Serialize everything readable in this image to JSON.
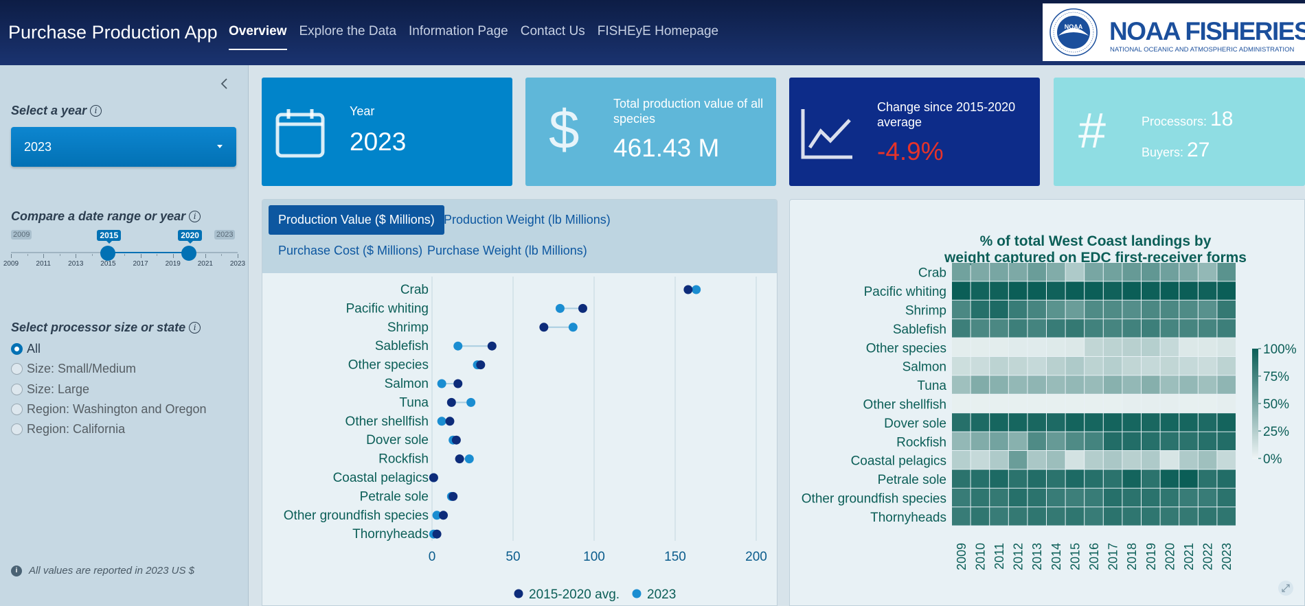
{
  "header": {
    "app_title": "Purchase Production App",
    "nav": [
      {
        "label": "Overview",
        "active": true
      },
      {
        "label": "Explore the Data",
        "active": false
      },
      {
        "label": "Information Page",
        "active": false
      },
      {
        "label": "Contact Us",
        "active": false
      },
      {
        "label": "FISHEyE Homepage",
        "active": false
      }
    ],
    "logo": {
      "emblem_text": "NOAA",
      "name": "NOAA FISHERIES",
      "subtitle": "NATIONAL OCEANIC AND ATMOSPHERIC ADMINISTRATION"
    }
  },
  "sidebar": {
    "year_label": "Select a year",
    "year_value": "2023",
    "range_label": "Compare a date range or year",
    "range": {
      "min": 2009,
      "max": 2023,
      "start": 2015,
      "end": 2020,
      "min_label": "2009",
      "max_label": "2023",
      "start_label": "2015",
      "end_label": "2020",
      "ticks": [
        "2009",
        "2011",
        "2013",
        "2015",
        "2017",
        "2019",
        "2021",
        "2023"
      ]
    },
    "processor_label": "Select processor size or state",
    "options": [
      {
        "label": "All",
        "checked": true
      },
      {
        "label": "Size: Small/Medium",
        "checked": false
      },
      {
        "label": "Size: Large",
        "checked": false
      },
      {
        "label": "Region: Washington and Oregon",
        "checked": false
      },
      {
        "label": "Region: California",
        "checked": false
      }
    ],
    "footnote": "All values are reported in 2023 US $"
  },
  "cards": {
    "year": {
      "label": "Year",
      "value": "2023",
      "icon": "calendar-icon"
    },
    "total": {
      "label": "Total production value of all species",
      "value": "461.43 M",
      "icon": "dollar-icon"
    },
    "change": {
      "label": "Change since 2015-2020 average",
      "value": "-4.9%",
      "value_color": "#e6332a",
      "icon": "line-chart-icon"
    },
    "counts": {
      "processors_label": "Processors:",
      "processors": "18",
      "buyers_label": "Buyers:",
      "buyers": "27",
      "icon": "hash-icon"
    }
  },
  "tabs": [
    {
      "label": "Production Value ($ Millions)",
      "active": true
    },
    {
      "label": "Production Weight (lb Millions)",
      "active": false
    },
    {
      "label": "Purchase Cost ($ Millions)",
      "active": false
    },
    {
      "label": "Purchase Weight (lb Millions)",
      "active": false
    }
  ],
  "colors": {
    "avg": "#0d2c7a",
    "year": "#1a8dd1",
    "heat_high": "#0b5e57",
    "heat_low": "#eef4f5",
    "accent": "#0271b4"
  },
  "chart_data": [
    {
      "type": "scatter",
      "subtype": "dumbbell",
      "categories": [
        "Crab",
        "Pacific whiting",
        "Shrimp",
        "Sablefish",
        "Other species",
        "Salmon",
        "Tuna",
        "Other shellfish",
        "Dover sole",
        "Rockfish",
        "Coastal pelagics",
        "Petrale sole",
        "Other groundfish species",
        "Thornyheads"
      ],
      "series": [
        {
          "name": "2015-2020 avg.",
          "values": [
            158,
            93,
            69,
            37,
            30,
            16,
            12,
            11,
            15,
            17,
            1,
            13,
            7,
            3
          ]
        },
        {
          "name": "2023",
          "values": [
            163,
            79,
            87,
            16,
            28,
            6,
            24,
            6,
            13,
            23,
            1,
            12,
            3,
            1
          ]
        }
      ],
      "xlim": [
        0,
        200
      ],
      "xticks": [
        "0",
        "50",
        "100",
        "150",
        "200"
      ],
      "legend_position": "bottom",
      "grid": true
    },
    {
      "type": "heatmap",
      "title": "% of total West Coast landings by weight captured on EDC first-receiver forms",
      "x": [
        "2009",
        "2010",
        "2011",
        "2012",
        "2013",
        "2014",
        "2015",
        "2016",
        "2017",
        "2018",
        "2019",
        "2020",
        "2021",
        "2022",
        "2023"
      ],
      "y": [
        "Crab",
        "Pacific whiting",
        "Shrimp",
        "Sablefish",
        "Other species",
        "Salmon",
        "Tuna",
        "Other shellfish",
        "Dover sole",
        "Rockfish",
        "Coastal pelagics",
        "Petrale sole",
        "Other groundfish species",
        "Thornyheads"
      ],
      "values": [
        [
          55,
          50,
          52,
          50,
          58,
          48,
          28,
          52,
          55,
          60,
          62,
          56,
          50,
          40,
          65
        ],
        [
          100,
          97,
          98,
          100,
          100,
          98,
          100,
          100,
          98,
          100,
          99,
          100,
          100,
          98,
          100
        ],
        [
          72,
          88,
          92,
          80,
          74,
          65,
          58,
          70,
          70,
          68,
          72,
          72,
          70,
          66,
          82
        ],
        [
          78,
          72,
          72,
          78,
          75,
          80,
          82,
          76,
          74,
          76,
          78,
          74,
          74,
          74,
          78
        ],
        [
          5,
          5,
          5,
          6,
          6,
          7,
          8,
          20,
          22,
          24,
          25,
          18,
          8,
          8,
          10
        ],
        [
          15,
          16,
          22,
          20,
          18,
          24,
          28,
          22,
          25,
          20,
          18,
          20,
          18,
          16,
          22
        ],
        [
          35,
          48,
          45,
          40,
          42,
          38,
          40,
          38,
          45,
          40,
          46,
          36,
          40,
          35,
          42
        ],
        [
          3,
          3,
          3,
          3,
          3,
          3,
          3,
          3,
          3,
          4,
          4,
          4,
          3,
          3,
          4
        ],
        [
          88,
          92,
          95,
          95,
          94,
          92,
          96,
          95,
          96,
          95,
          94,
          95,
          95,
          92,
          96
        ],
        [
          40,
          48,
          54,
          45,
          70,
          60,
          70,
          75,
          90,
          90,
          88,
          86,
          86,
          88,
          90
        ],
        [
          25,
          18,
          28,
          58,
          30,
          36,
          12,
          26,
          30,
          24,
          28,
          10,
          28,
          35,
          18
        ],
        [
          86,
          88,
          92,
          86,
          90,
          86,
          92,
          88,
          86,
          96,
          86,
          98,
          100,
          86,
          90
        ],
        [
          80,
          84,
          82,
          88,
          86,
          80,
          78,
          80,
          88,
          86,
          86,
          84,
          80,
          80,
          86
        ],
        [
          80,
          84,
          80,
          82,
          84,
          82,
          84,
          80,
          86,
          84,
          84,
          82,
          82,
          84,
          84
        ]
      ],
      "colorbar_ticks": [
        "100%",
        "75%",
        "50%",
        "25%",
        "0%"
      ],
      "zlim": [
        0,
        100
      ],
      "legend_position": "right"
    }
  ]
}
